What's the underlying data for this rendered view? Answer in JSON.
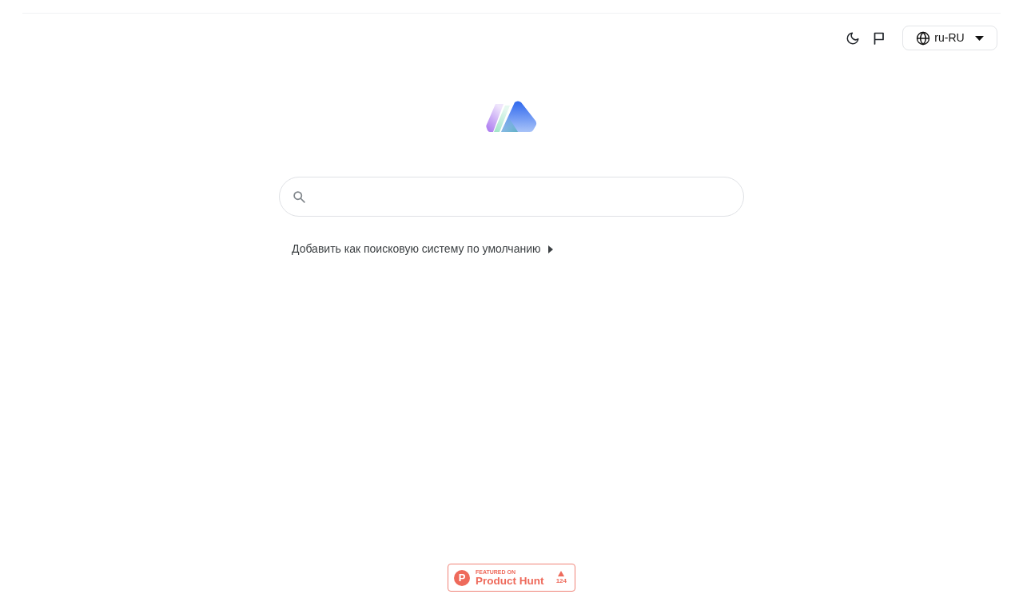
{
  "header": {
    "language_selector": {
      "value": "ru-RU"
    }
  },
  "default_search_link": "Добавить как поисковую систему по умолчанию",
  "product_hunt_badge": {
    "logo_letter": "P",
    "caption": "FEATURED ON",
    "name": "Product Hunt",
    "votes": "124"
  }
}
